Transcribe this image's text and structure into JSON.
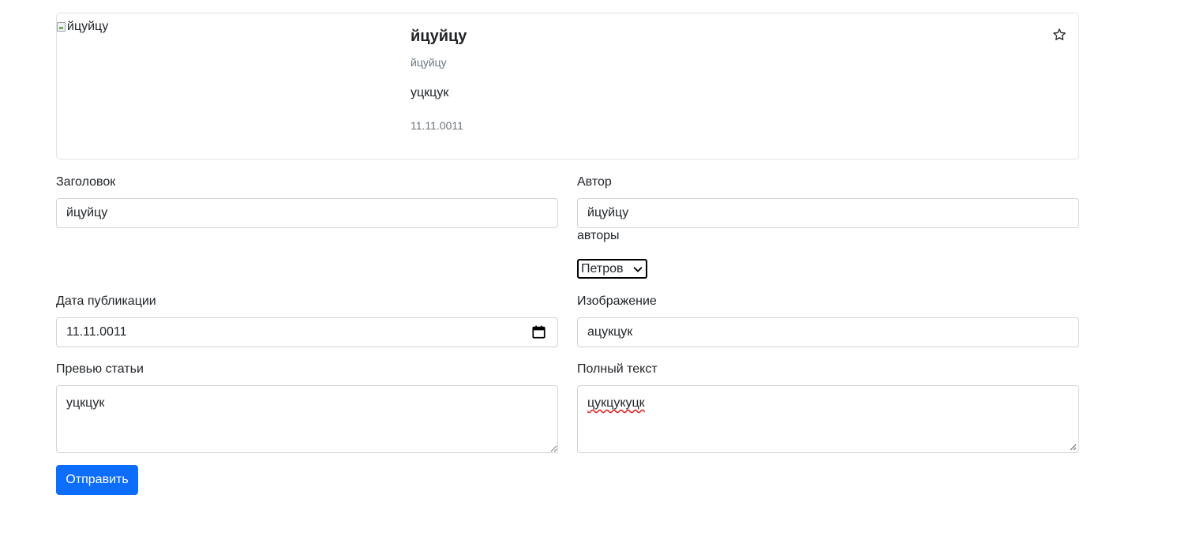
{
  "card": {
    "image_alt": "йцуйцу",
    "title": "йцуйцу",
    "subtitle": "йцуйцу",
    "preview": "уцкцук",
    "date": "11.11.0011",
    "favorite_icon": "star-outline-icon"
  },
  "form": {
    "title_label": "Заголовок",
    "title_value": "йцуйцу",
    "author_label": "Автор",
    "author_value": "йцуйцу",
    "authors_label": "авторы",
    "authors_selected": "Петров",
    "date_label": "Дата публикации",
    "date_value": "11.11.0011",
    "image_label": "Изображение",
    "image_value": "ацукцук",
    "preview_label": "Превью статьи",
    "preview_value": "уцкцук",
    "fulltext_label": "Полный текст",
    "fulltext_value": "цукцукуцк",
    "submit_label": "Отправить"
  },
  "colors": {
    "primary": "#0d6efd",
    "border": "#ced4da",
    "muted": "#6c757d",
    "spellcheck": "#e0262b"
  }
}
